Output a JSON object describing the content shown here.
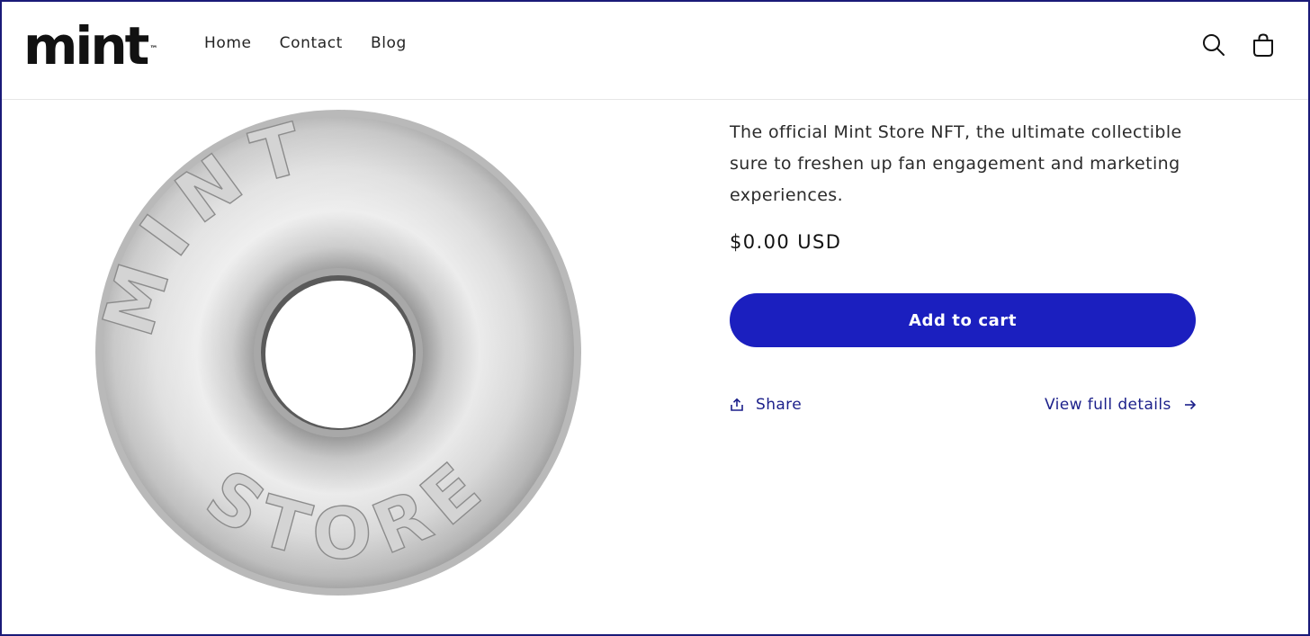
{
  "header": {
    "logo_text": "mint",
    "logo_tm": "™",
    "nav": [
      {
        "label": "Home"
      },
      {
        "label": "Contact"
      },
      {
        "label": "Blog"
      }
    ],
    "icons": {
      "search": "search-icon",
      "cart": "cart-icon"
    }
  },
  "product": {
    "image_alt": "Mint Store NFT coin",
    "coin_text_top": "MINT",
    "coin_text_bottom": "STORE",
    "description": "The official Mint Store NFT, the ultimate collectible sure to freshen up fan engagement and marketing experiences.",
    "price": "$0.00 USD",
    "add_to_cart_label": "Add to cart",
    "share_label": "Share",
    "view_details_label": "View full details"
  },
  "colors": {
    "accent": "#1b1fbf",
    "link": "#1b1f8a",
    "frame_border": "#1a1a78"
  }
}
